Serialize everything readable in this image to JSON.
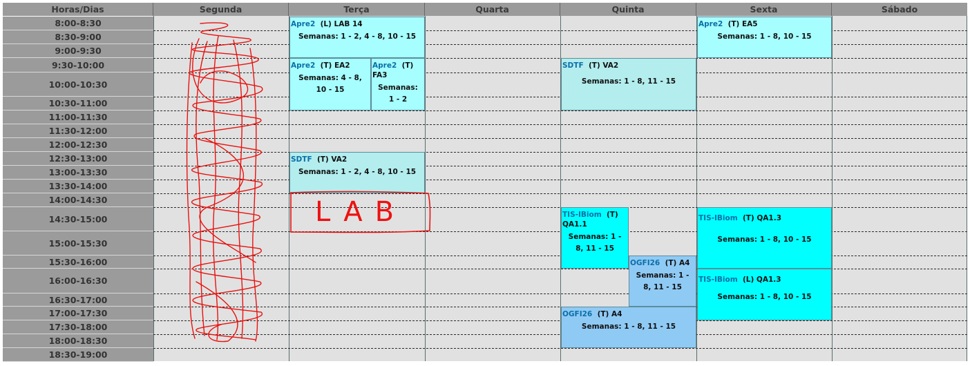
{
  "header": {
    "time_label": "Horas/Dias",
    "days": [
      "Segunda",
      "Terça",
      "Quarta",
      "Quinta",
      "Sexta",
      "Sábado"
    ]
  },
  "times": [
    "8:00-8:30",
    "8:30-9:00",
    "9:00-9:30",
    "9:30-10:00",
    "10:00-10:30",
    "10:30-11:00",
    "11:00-11:30",
    "11:30-12:00",
    "12:00-12:30",
    "12:30-13:00",
    "13:00-13:30",
    "13:30-14:00",
    "14:00-14:30",
    "14:30-15:00",
    "15:00-15:30",
    "15:30-16:00",
    "16:00-16:30",
    "16:30-17:00",
    "17:00-17:30",
    "17:30-18:00",
    "18:00-18:30",
    "18:30-19:00"
  ],
  "events": {
    "tue_apre2_lab14": {
      "code": "Apre2",
      "info": "(L) LAB 14",
      "weeks": "Semanas:  1 - 2, 4 - 8, 10 - 15"
    },
    "tue_apre2_ea2": {
      "code": "Apre2",
      "info": "(T) EA2",
      "weeks": "Semanas:  4 - 8, 10 - 15"
    },
    "tue_apre2_fa3": {
      "code": "Apre2",
      "info": "(T) FA3",
      "weeks": "Semanas:  1 - 2"
    },
    "tue_sdtf_va2": {
      "code": "SDTF",
      "info": "(T) VA2",
      "weeks": "Semanas:  1 - 2, 4 - 8, 10 - 15"
    },
    "thu_sdtf_va2": {
      "code": "SDTF",
      "info": "(T) VA2",
      "weeks": "Semanas:  1 - 8, 11 - 15"
    },
    "thu_tis_qa11": {
      "code": "TIS-IBiom",
      "info": "(T) QA1.1",
      "weeks": "Semanas:  1 - 8, 11 - 15"
    },
    "thu_ogfi_a4_a": {
      "code": "OGFI26",
      "info": "(T) A4",
      "weeks": "Semanas:  1 - 8, 11 - 15"
    },
    "thu_ogfi_a4_b": {
      "code": "OGFI26",
      "info": "(T) A4",
      "weeks": "Semanas:  1 - 8, 11 - 15"
    },
    "fri_apre2_ea5": {
      "code": "Apre2",
      "info": "(T) EA5",
      "weeks": "Semanas:  1 - 8, 10 - 15"
    },
    "fri_tis_qa13_t": {
      "code": "TIS-IBiom",
      "info": "(T) QA1.3",
      "weeks": "Semanas:  1 - 8, 10 - 15"
    },
    "fri_tis_qa13_l": {
      "code": "TIS-IBiom",
      "info": "(L) QA1.3",
      "weeks": "Semanas:  1 - 8, 10 - 15"
    }
  },
  "annotation": {
    "text": "LAB",
    "color": "#ee1111"
  },
  "colors": {
    "header_bg": "#9b9b9b",
    "cell_bg": "#e1e1e1",
    "event_cyan_light": "#a6feff",
    "event_teal": "#b3edee",
    "event_cyan": "#00ffff",
    "event_blue": "#8fcaf5",
    "code_link": "#0a6fa7"
  }
}
